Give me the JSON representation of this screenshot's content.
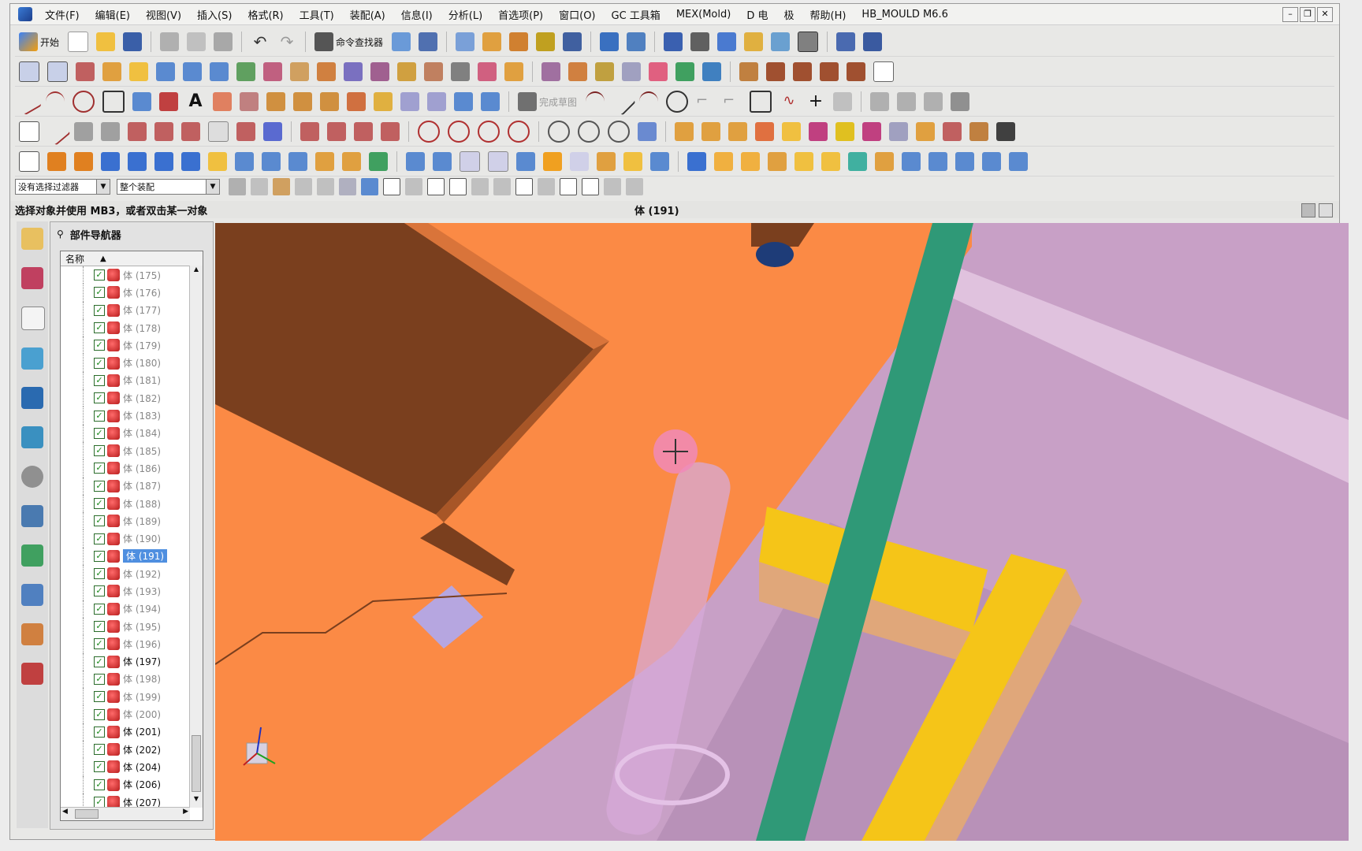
{
  "menu": {
    "items": [
      "文件(F)",
      "编辑(E)",
      "视图(V)",
      "插入(S)",
      "格式(R)",
      "工具(T)",
      "装配(A)",
      "信息(I)",
      "分析(L)",
      "首选项(P)",
      "窗口(O)",
      "GC 工具箱",
      "MEX(Mold)",
      "D 电",
      "极",
      "帮助(H)",
      "HB_MOULD M6.6"
    ]
  },
  "toolbar": {
    "start_label": "开始",
    "cmd_finder_label": "命令查找器",
    "finish_sketch_label": "完成草图"
  },
  "filters": {
    "select_filter": "没有选择过滤器",
    "assembly_scope": "整个装配"
  },
  "status": {
    "prompt": "选择对象并使用 MB3，或者双击某一对象",
    "selection": "体 (191)"
  },
  "navigator": {
    "title": "部件导航器",
    "column_header": "名称",
    "rows": [
      {
        "label": "体 (175)",
        "dim": true
      },
      {
        "label": "体 (176)",
        "dim": true
      },
      {
        "label": "体 (177)",
        "dim": true
      },
      {
        "label": "体 (178)",
        "dim": true
      },
      {
        "label": "体 (179)",
        "dim": true
      },
      {
        "label": "体 (180)",
        "dim": true
      },
      {
        "label": "体 (181)",
        "dim": true
      },
      {
        "label": "体 (182)",
        "dim": true
      },
      {
        "label": "体 (183)",
        "dim": true
      },
      {
        "label": "体 (184)",
        "dim": true
      },
      {
        "label": "体 (185)",
        "dim": true
      },
      {
        "label": "体 (186)",
        "dim": true
      },
      {
        "label": "体 (187)",
        "dim": true
      },
      {
        "label": "体 (188)",
        "dim": true
      },
      {
        "label": "体 (189)",
        "dim": true
      },
      {
        "label": "体 (190)",
        "dim": true
      },
      {
        "label": "体 (191)",
        "dim": true,
        "selected": true
      },
      {
        "label": "体 (192)",
        "dim": true
      },
      {
        "label": "体 (193)",
        "dim": true
      },
      {
        "label": "体 (194)",
        "dim": true
      },
      {
        "label": "体 (195)",
        "dim": true
      },
      {
        "label": "体 (196)",
        "dim": true
      },
      {
        "label": "体 (197)",
        "dim": false
      },
      {
        "label": "体 (198)",
        "dim": true
      },
      {
        "label": "体 (199)",
        "dim": true
      },
      {
        "label": "体 (200)",
        "dim": true
      },
      {
        "label": "体 (201)",
        "dim": false
      },
      {
        "label": "体 (202)",
        "dim": false
      },
      {
        "label": "体 (204)",
        "dim": false
      },
      {
        "label": "体 (206)",
        "dim": false
      },
      {
        "label": "体 (207)",
        "dim": false
      }
    ]
  },
  "sidebar": {
    "icons": [
      "assembly-navigator-icon",
      "constraint-navigator-icon",
      "part-navigator-icon",
      "reuse-library-icon",
      "hd3d-tools-icon",
      "web-browser-icon",
      "history-icon",
      "system-materials-icon",
      "process-studio-icon",
      "manufacturing-wizard-icon",
      "roles-icon",
      "system-scenes-icon"
    ]
  },
  "colors": {
    "orange_plate": "#fb8a45",
    "shadow_wall": "#7a3f1e",
    "purple_body": "#c8a0c6",
    "green_pin": "#2f9977",
    "yellow_part": "#f5c518",
    "selection_blue": "#4f8fe0"
  }
}
